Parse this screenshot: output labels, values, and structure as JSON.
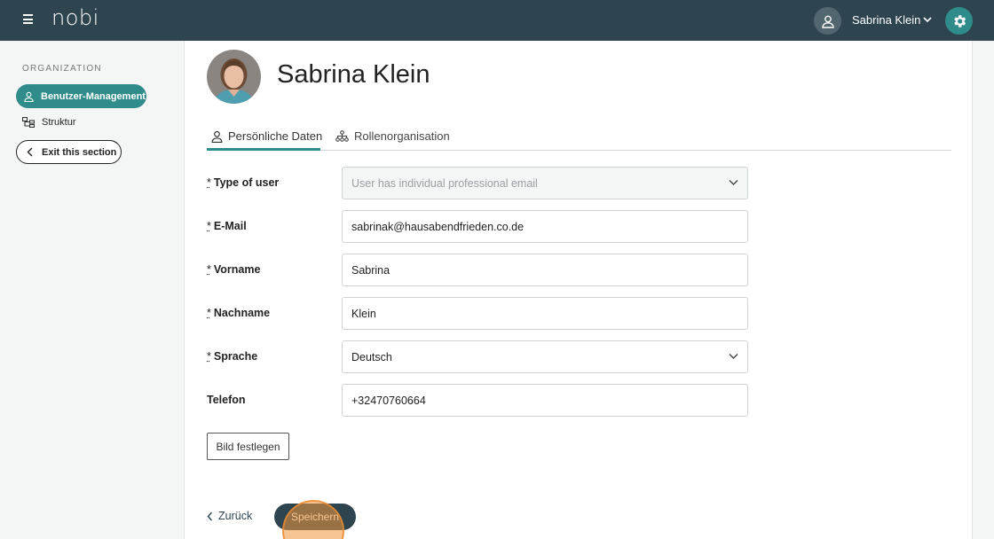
{
  "header": {
    "logo": "nobi",
    "user_name": "Sabrina Klein",
    "icons": {
      "menu": "hamburger-icon",
      "user": "user-icon",
      "dropdown": "chevron-down-icon",
      "settings": "gear-icon"
    }
  },
  "sidebar": {
    "section_label": "ORGANIZATION",
    "items": [
      {
        "label": "Benutzer-Management",
        "icon": "user-icon",
        "active": true
      },
      {
        "label": "Struktur",
        "icon": "structure-icon",
        "active": false
      }
    ],
    "exit_label": "Exit this section"
  },
  "profile": {
    "name": "Sabrina Klein"
  },
  "tabs": [
    {
      "label": "Persönliche Daten",
      "icon": "user-icon",
      "active": true
    },
    {
      "label": "Rollenorganisation",
      "icon": "org-chart-icon",
      "active": false
    }
  ],
  "form": {
    "required_marker": "*",
    "fields": [
      {
        "label": "Type of user",
        "required": true,
        "value": "User has individual professional email",
        "type": "select",
        "disabled": true
      },
      {
        "label": "E-Mail",
        "required": true,
        "value": "sabrinak@hausabendfrieden.co.de",
        "type": "text"
      },
      {
        "label": "Vorname",
        "required": true,
        "value": "Sabrina",
        "type": "text"
      },
      {
        "label": "Nachname",
        "required": true,
        "value": "Klein",
        "type": "text"
      },
      {
        "label": "Sprache",
        "required": true,
        "value": "Deutsch",
        "type": "select"
      },
      {
        "label": "Telefon",
        "required": false,
        "value": "+32470760664",
        "type": "text"
      }
    ],
    "set_image_label": "Bild festlegen"
  },
  "footer": {
    "back_label": "Zurück",
    "save_label": "Speichern"
  },
  "colors": {
    "topbar": "#2e4550",
    "accent": "#2f8c8a",
    "click_highlight": "#f0963c"
  }
}
